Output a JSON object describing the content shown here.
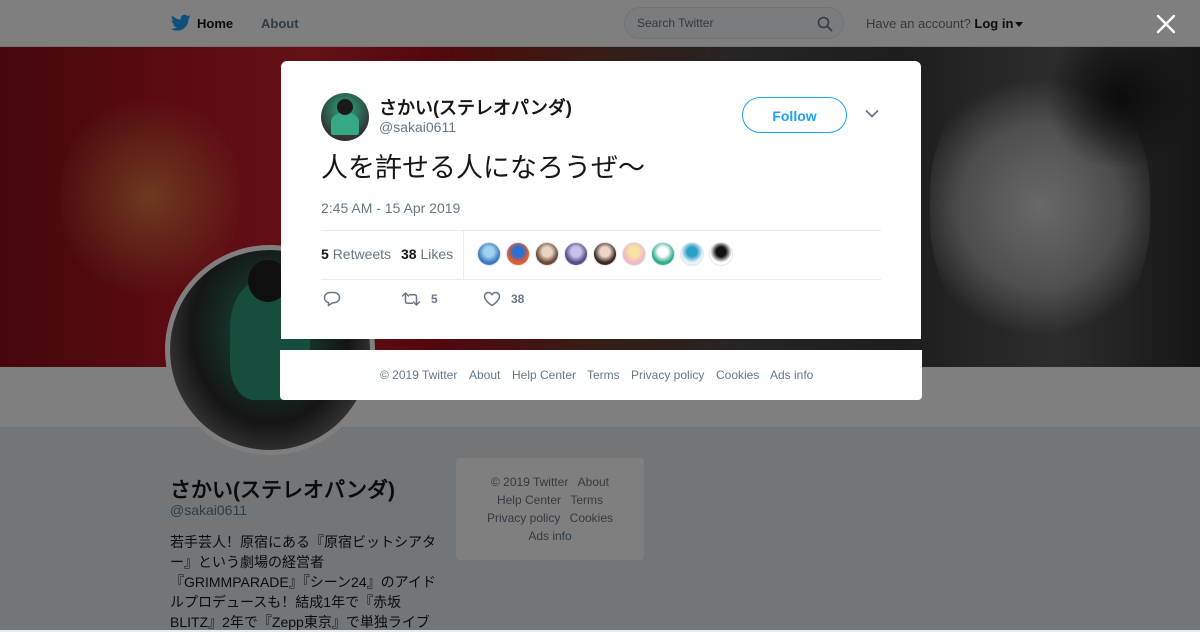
{
  "topbar": {
    "home_label": "Home",
    "about_label": "About",
    "search_placeholder": "Search Twitter",
    "account_prompt": "Have an account?",
    "login_label": "Log in"
  },
  "profile": {
    "name": "さかい(ステレオパンダ)",
    "handle": "@sakai0611",
    "bio": "若手芸人！原宿にある『原宿ビットシアター』という劇場の経営者『GRIMMPARADE』『シーン24』のアイドルプロデュースも！結成1年で『赤坂BLITZ』2年で『Zepp東京』で単独ライブ"
  },
  "side_footer": {
    "copyright": "© 2019 Twitter",
    "about": "About",
    "help": "Help Center",
    "terms": "Terms",
    "privacy": "Privacy policy",
    "cookies": "Cookies",
    "ads": "Ads info"
  },
  "tweet": {
    "author_name": "さかい(ステレオパンダ)",
    "author_handle": "@sakai0611",
    "follow_label": "Follow",
    "text": "人を許せる人になろうぜ〜",
    "timestamp": "2:45 AM - 15 Apr 2019",
    "retweets_count": "5",
    "retweets_label": "Retweets",
    "likes_count": "38",
    "likes_label": "Likes",
    "action_retweet_count": "5",
    "action_like_count": "38",
    "likers": [
      {
        "color": "#3c7bbf",
        "accent": "#9fd3f0"
      },
      {
        "color": "#e85b2a",
        "accent": "#2a6fd1"
      },
      {
        "color": "#6b4a36",
        "accent": "#e8d3c0"
      },
      {
        "color": "#5a4b8a",
        "accent": "#c9c2e8"
      },
      {
        "color": "#3b2a22",
        "accent": "#f0d5c8"
      },
      {
        "color": "#f2b8c6",
        "accent": "#f9e3a0"
      },
      {
        "color": "#2fae8b",
        "accent": "#ffffff"
      },
      {
        "color": "#e8f4f8",
        "accent": "#2aa0c9"
      },
      {
        "color": "#ffffff",
        "accent": "#111111"
      }
    ]
  },
  "modal_footer": {
    "copyright": "© 2019 Twitter",
    "about": "About",
    "help": "Help Center",
    "terms": "Terms",
    "privacy": "Privacy policy",
    "cookies": "Cookies",
    "ads": "Ads info"
  },
  "colors": {
    "brand": "#1da1f2",
    "overlay": "rgba(0,0,0,0.5)"
  }
}
